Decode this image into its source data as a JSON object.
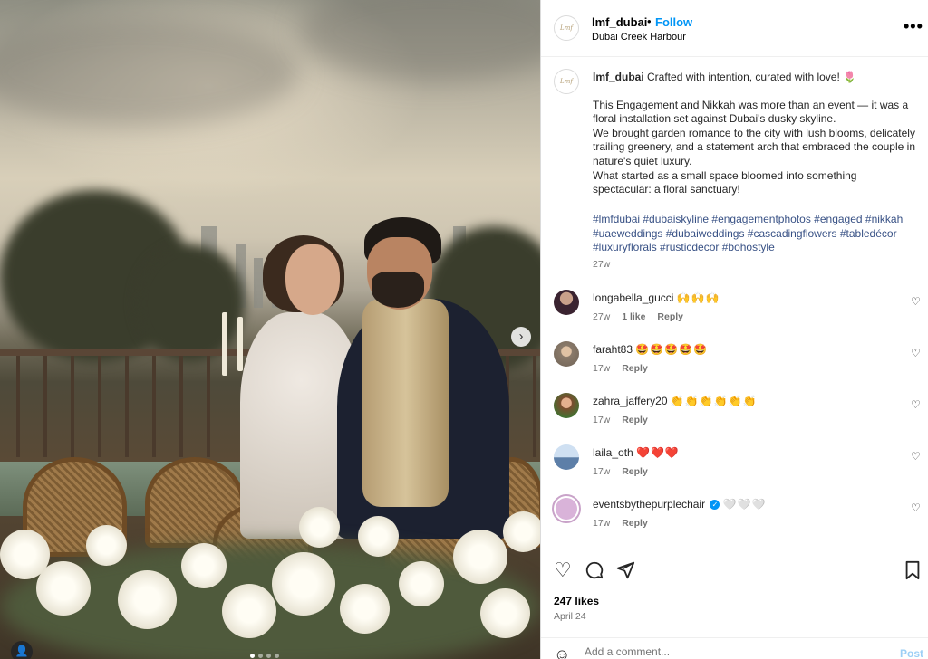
{
  "post": {
    "username": "lmf_dubai",
    "separator": "•",
    "follow_label": "Follow",
    "location": "Dubai Creek Harbour",
    "more_label": "•••",
    "logo_text": "Lmf"
  },
  "caption": {
    "username": "lmf_dubai",
    "line1": "Crafted with intention, curated with love! 🌷",
    "para1": "This Engagement and Nikkah was more than an event — it was a floral installation set against Dubai's dusky skyline.",
    "para2": "We brought garden romance to the city with lush blooms, delicately trailing greenery, and a statement arch that embraced the couple in nature's quiet luxury.",
    "para3": "What started as a small space bloomed into something spectacular: a floral sanctuary!",
    "hashtags": "#lmfdubai #dubaiskyline #engagementphotos #engaged #nikkah #uaeweddings #dubaiweddings #cascadingflowers #tabledécor #luxuryflorals #rusticdecor #bohostyle",
    "time": "27w"
  },
  "comments": [
    {
      "username": "longabella_gucci",
      "text": "🙌🙌🙌",
      "time": "27w",
      "likes": "1 like",
      "reply": "Reply",
      "avatar_color": "#3a2330"
    },
    {
      "username": "faraht83",
      "text": "🤩🤩🤩🤩🤩",
      "time": "17w",
      "likes": "",
      "reply": "Reply",
      "avatar_color": "#8a7a6a"
    },
    {
      "username": "zahra_jaffery20",
      "text": "👏👏👏👏👏👏",
      "time": "17w",
      "likes": "",
      "reply": "Reply",
      "avatar_color": "#c98a6a"
    },
    {
      "username": "laila_oth",
      "text": "❤️❤️❤️",
      "time": "17w",
      "likes": "",
      "reply": "Reply",
      "avatar_color": "#9fb9d6"
    },
    {
      "username": "eventsbythepurplechair",
      "text": "🤍🤍🤍",
      "time": "17w",
      "likes": "",
      "reply": "Reply",
      "avatar_color": "#c9a3c9"
    }
  ],
  "actions": {
    "likes": "247 likes",
    "date": "April 24",
    "comment_placeholder": "Add a comment...",
    "post_label": "Post"
  },
  "carousel": {
    "slide_count": 4,
    "active_index": 0
  }
}
